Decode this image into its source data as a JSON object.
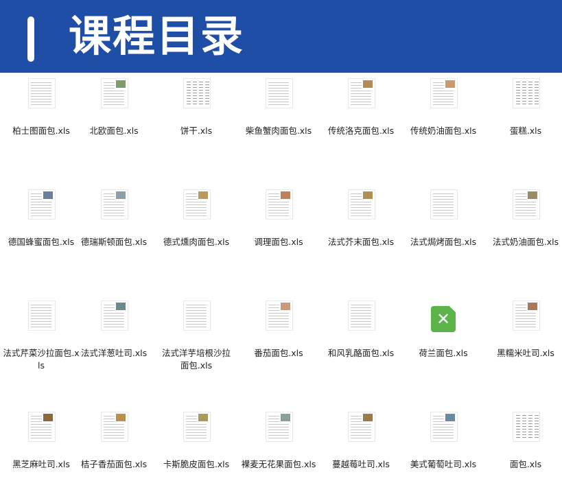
{
  "banner": {
    "title": "课程目录"
  },
  "colors": {
    "banner": "#1f4ea6",
    "excel_green": "#5bb34a"
  },
  "files": [
    {
      "name": "柏士图面包.xls",
      "thumb": "sheet",
      "photo": ""
    },
    {
      "name": "北欧面包.xls",
      "thumb": "sheet",
      "photo": "#7c9a6a"
    },
    {
      "name": "饼干.xls",
      "thumb": "dense",
      "photo": ""
    },
    {
      "name": "柴鱼蟹肉面包.xls",
      "thumb": "sheet",
      "photo": ""
    },
    {
      "name": "传统洛克面包.xls",
      "thumb": "sheet",
      "photo": "#b58a54"
    },
    {
      "name": "传统奶油面包.xls",
      "thumb": "sheet",
      "photo": "#c89a6c"
    },
    {
      "name": "蛋糕.xls",
      "thumb": "dense",
      "photo": ""
    },
    {
      "name": "德国蜂蜜面包.xls",
      "thumb": "sheet",
      "photo": "#6a7f9c"
    },
    {
      "name": "德瑞斯顿面包.xls",
      "thumb": "sheet",
      "photo": "#8aa0a6"
    },
    {
      "name": "德式燻肉面包.xls",
      "thumb": "sheet",
      "photo": "#b89a5a"
    },
    {
      "name": "调理面包.xls",
      "thumb": "sheet",
      "photo": "#c0805a"
    },
    {
      "name": "法式芥末面包.xls",
      "thumb": "sheet",
      "photo": "#b0904e"
    },
    {
      "name": "法式焗烤面包.xls",
      "thumb": "sheet",
      "photo": ""
    },
    {
      "name": "法式奶油面包.xls",
      "thumb": "sheet",
      "photo": "#9a8a6a"
    },
    {
      "name": "法式芹菜沙拉面包.xls",
      "thumb": "sheet",
      "photo": ""
    },
    {
      "name": "法式洋葱吐司.xls",
      "thumb": "sheet",
      "photo": "#6a8a8c"
    },
    {
      "name": "法式洋芋培根沙拉面包.xls",
      "thumb": "sheet",
      "photo": ""
    },
    {
      "name": "番茄面包.xls",
      "thumb": "sheet",
      "photo": "#c89a7a"
    },
    {
      "name": "和风乳酪面包.xls",
      "thumb": "sheet",
      "photo": ""
    },
    {
      "name": "荷兰面包.xls",
      "thumb": "excel",
      "photo": ""
    },
    {
      "name": "黑糯米吐司.xls",
      "thumb": "sheet",
      "photo": "#a87a5a"
    },
    {
      "name": "黑芝麻吐司.xls",
      "thumb": "sheet",
      "photo": "#8a6a3c"
    },
    {
      "name": "桔子香茄面包.xls",
      "thumb": "sheet",
      "photo": "#b8904a"
    },
    {
      "name": "卡斯脆皮面包.xls",
      "thumb": "sheet",
      "photo": "#a89a5a"
    },
    {
      "name": "裸麦无花果面包.xls",
      "thumb": "sheet",
      "photo": "#8aa09a"
    },
    {
      "name": "蔓越莓吐司.xls",
      "thumb": "sheet",
      "photo": "#9a7a4a"
    },
    {
      "name": "美式葡萄吐司.xls",
      "thumb": "sheet",
      "photo": "#6a8aa0"
    },
    {
      "name": "面包.xls",
      "thumb": "dense",
      "photo": ""
    }
  ]
}
